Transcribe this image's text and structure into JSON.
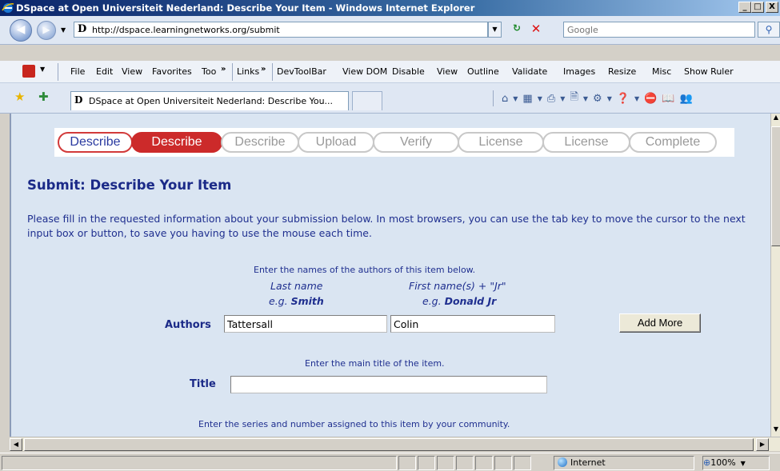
{
  "window": {
    "title": "DSpace at Open Universiteit Nederland: Describe Your Item - Windows Internet Explorer",
    "min": "_",
    "max": "□",
    "close": "X"
  },
  "address": {
    "url": "http://dspace.learningnetworks.org/submit",
    "search_placeholder": "Google"
  },
  "menu": {
    "file": "File",
    "edit": "Edit",
    "view": "View",
    "favorites": "Favorites",
    "tools": "Too",
    "links": "Links",
    "links_items": [
      "DevToolBar",
      "View DOM",
      "Disable",
      "View",
      "Outline",
      "Validate",
      "Images",
      "Resize",
      "Misc",
      "Show Ruler"
    ]
  },
  "tab": {
    "label": "DSpace at Open Universiteit Nederland: Describe You..."
  },
  "progress": {
    "steps": [
      {
        "label": "Describe",
        "state": "done"
      },
      {
        "label": "Describe",
        "state": "current"
      },
      {
        "label": "Describe",
        "state": "todo"
      },
      {
        "label": "Upload",
        "state": "todo"
      },
      {
        "label": "Verify",
        "state": "todo"
      },
      {
        "label": "License",
        "state": "todo"
      },
      {
        "label": "License",
        "state": "todo"
      },
      {
        "label": "Complete",
        "state": "todo"
      }
    ]
  },
  "page": {
    "heading": "Submit: Describe Your Item",
    "intro": "Please fill in the requested information about your submission below. In most browsers, you can use the tab key to move the cursor to the next input box or button, to save you having to use the mouse each time."
  },
  "authors": {
    "hint": "Enter the names of the authors of this item below.",
    "last_name_label": "Last name",
    "first_name_label": "First name(s) + \"Jr\"",
    "eg": "e.g.",
    "last_example": "Smith",
    "first_example": "Donald Jr",
    "label": "Authors",
    "last_value": "Tattersall",
    "first_value": "Colin",
    "add_more": "Add More"
  },
  "title_field": {
    "hint": "Enter the main title of the item.",
    "label": "Title",
    "value": ""
  },
  "series": {
    "hint": "Enter the series and number assigned to this item by your community."
  },
  "status": {
    "zone": "Internet",
    "zoom": "100%"
  },
  "colors": {
    "accent_red": "#cc2a2a",
    "link_blue": "#1b2a88",
    "page_bg": "#dae5f2"
  }
}
